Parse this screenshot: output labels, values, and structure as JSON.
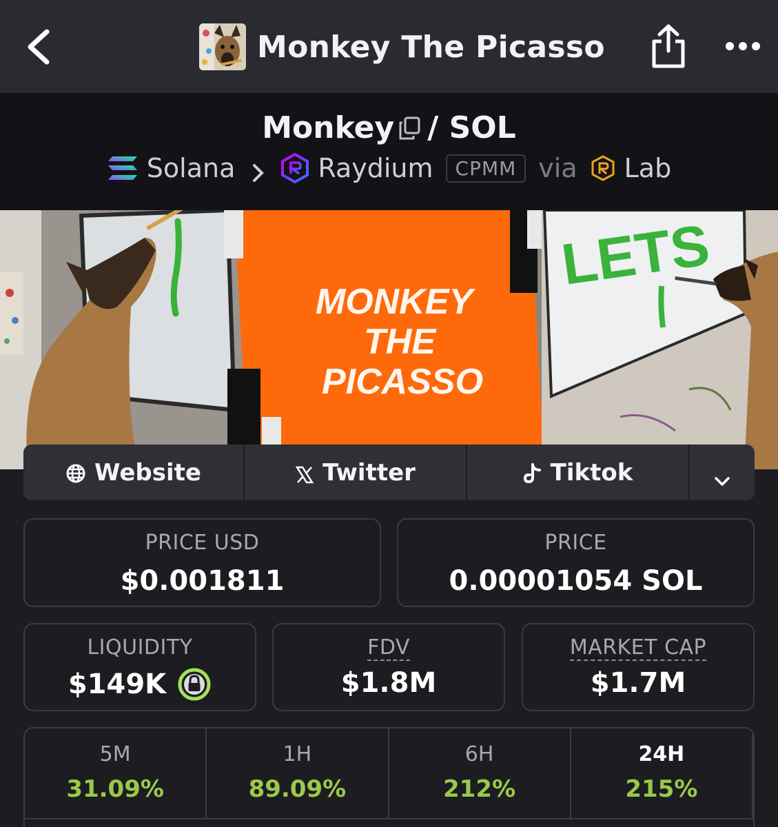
{
  "header": {
    "title": "Monkey The Picasso",
    "back_icon": "chevron-left-icon",
    "share_icon": "share-icon",
    "more_icon": "more-dots-icon"
  },
  "pair": {
    "base": "Monkey",
    "separator": "/",
    "quote": "SOL",
    "chain": "Solana",
    "dex": "Raydium",
    "pool_type": "CPMM",
    "via_label": "via",
    "via_name": "Lab"
  },
  "banner": {
    "text_line1": "MONKEY",
    "text_line2": "THE",
    "text_line3": "PICASSO",
    "board_text": "LETS"
  },
  "links": {
    "website": "Website",
    "twitter": "Twitter",
    "tiktok": "Tiktok"
  },
  "stats": {
    "price_usd_label": "PRICE USD",
    "price_usd": "$0.001811",
    "price_label": "PRICE",
    "price": "0.00001054 SOL",
    "liquidity_label": "LIQUIDITY",
    "liquidity": "$149K",
    "fdv_label": "FDV",
    "fdv": "$1.8M",
    "mcap_label": "MARKET CAP",
    "mcap": "$1.7M"
  },
  "changes": [
    {
      "label": "5M",
      "value": "31.09%"
    },
    {
      "label": "1H",
      "value": "89.09%"
    },
    {
      "label": "6H",
      "value": "212%"
    },
    {
      "label": "24H",
      "value": "215%"
    }
  ],
  "colors": {
    "positive": "#9ac94a",
    "banner_orange": "#fe6a0b",
    "lock_ring": "#a6e05a"
  }
}
